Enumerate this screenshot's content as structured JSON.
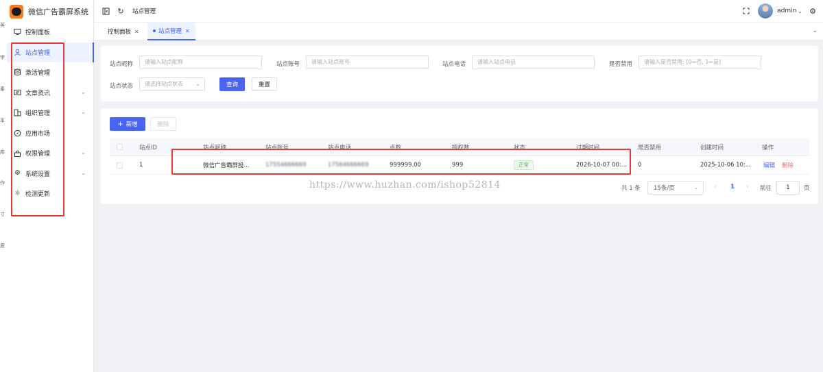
{
  "edge_strip": [
    "英",
    "字",
    "素",
    "本",
    "库",
    "作",
    "寸",
    "质"
  ],
  "app": {
    "name": "微信广告霸屏系统"
  },
  "sidebar": {
    "items": [
      {
        "label": "控制面板",
        "icon": "monitor-icon",
        "has_children": false,
        "active": false
      },
      {
        "label": "站点管理",
        "icon": "user-icon",
        "has_children": false,
        "active": true
      },
      {
        "label": "激活管理",
        "icon": "database-icon",
        "has_children": false,
        "active": false
      },
      {
        "label": "文章资讯",
        "icon": "message-icon",
        "has_children": true,
        "active": false
      },
      {
        "label": "组织管理",
        "icon": "organization-icon",
        "has_children": true,
        "active": false
      },
      {
        "label": "应用市场",
        "icon": "compass-icon",
        "has_children": false,
        "active": false
      },
      {
        "label": "权限管理",
        "icon": "lock-icon",
        "has_children": true,
        "active": false
      },
      {
        "label": "系统设置",
        "icon": "gear-icon",
        "has_children": true,
        "active": false
      },
      {
        "label": "检测更新",
        "icon": "sun-icon",
        "has_children": false,
        "active": false
      }
    ]
  },
  "header": {
    "breadcrumb": "站点管理",
    "user": "admin"
  },
  "tabs": [
    {
      "label": "控制面板",
      "active": false
    },
    {
      "label": "站点管理",
      "active": true
    }
  ],
  "search": {
    "nickname_label": "站点昵称",
    "nickname_placeholder": "请输入站点昵称",
    "account_label": "站点账号",
    "account_placeholder": "请输入站点账号",
    "phone_label": "站点电话",
    "phone_placeholder": "请输入站点电话",
    "disabled_label": "是否禁用",
    "disabled_placeholder": "请输入是否禁用: [0=否, 1=是]",
    "status_label": "站点状态",
    "status_placeholder": "请选择站点状态",
    "query_button": "查询",
    "reset_button": "重置"
  },
  "toolbar": {
    "add_button": "新增",
    "delete_button": "删除"
  },
  "table": {
    "columns": [
      "站点ID",
      "站点昵称",
      "站点账号",
      "站点电话",
      "点数",
      "授权数",
      "状态",
      "过期时间",
      "是否禁用",
      "创建时间",
      "操作"
    ],
    "rows": [
      {
        "id": "1",
        "nickname": "微信广告霸屏投...",
        "account": "17554666669",
        "phone": "17564666669",
        "points": "999999.00",
        "licenses": "999",
        "status": "正常",
        "expire": "2026-10-07 00:...",
        "disabled": "0",
        "created": "2025-10-06 10:...",
        "edit": "编辑",
        "delete": "删除"
      }
    ]
  },
  "pagination": {
    "total": "共 1 条",
    "page_size": "15条/页",
    "current_page": "1",
    "goto_label": "前往",
    "goto_value": "1",
    "page_suffix": "页"
  },
  "watermark": "https://www.huzhan.com/ishop52814",
  "colors": {
    "primary": "#4964f0",
    "danger": "#f56c6c",
    "success": "#52b35a",
    "annotation": "#e53935"
  }
}
